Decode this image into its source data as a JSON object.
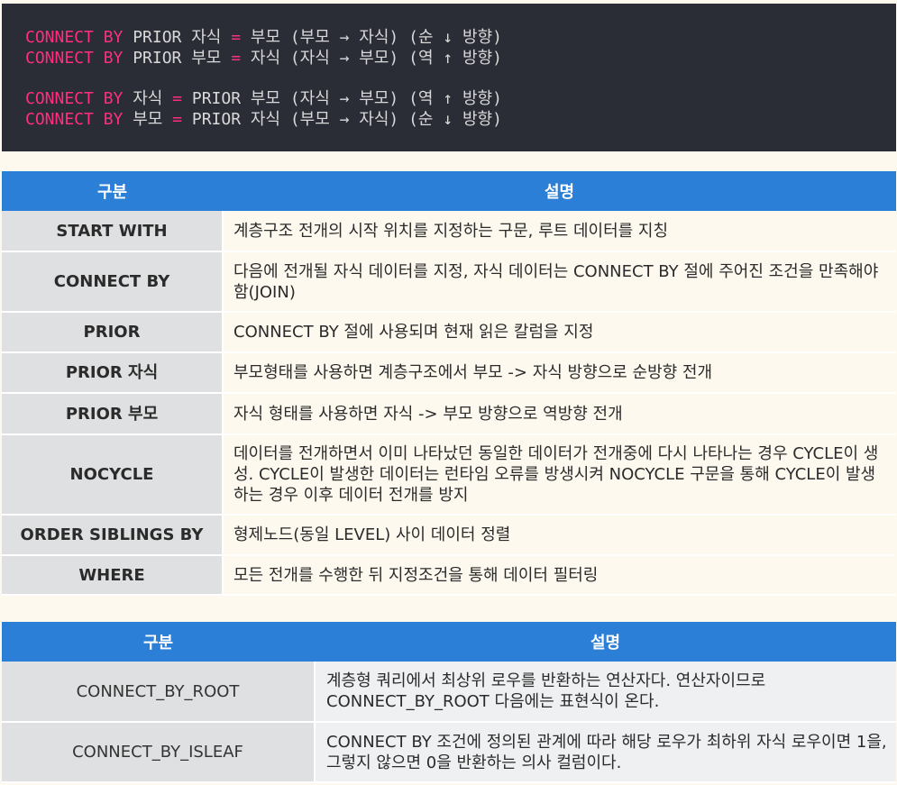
{
  "code": {
    "lines": [
      [
        {
          "t": "CONNECT BY",
          "c": "kw"
        },
        {
          "t": " PRIOR 자식 ",
          "c": ""
        },
        {
          "t": "=",
          "c": "op"
        },
        {
          "t": " 부모 (부모 → 자식) (순 ↓ 방향)",
          "c": ""
        }
      ],
      [
        {
          "t": "CONNECT BY",
          "c": "kw"
        },
        {
          "t": " PRIOR 부모 ",
          "c": ""
        },
        {
          "t": "=",
          "c": "op"
        },
        {
          "t": " 자식 (자식 → 부모) (역 ↑ 방향)",
          "c": ""
        }
      ],
      [
        {
          "t": "CONNECT BY",
          "c": "kw"
        },
        {
          "t": " 자식 ",
          "c": ""
        },
        {
          "t": "=",
          "c": "op"
        },
        {
          "t": " PRIOR 부모 (자식 → 부모) (역 ↑ 방향)",
          "c": ""
        }
      ],
      [
        {
          "t": "CONNECT BY",
          "c": "kw"
        },
        {
          "t": " 부모 ",
          "c": ""
        },
        {
          "t": "=",
          "c": "op"
        },
        {
          "t": " PRIOR 자식 (부모 → 자식) (순 ↓ 방향)",
          "c": ""
        }
      ]
    ]
  },
  "table1": {
    "header_key": "구분",
    "header_desc": "설명",
    "rows": [
      {
        "key": "START WITH",
        "desc": "계층구조 전개의 시작 위치를 지정하는 구문, 루트 데이터를 지칭"
      },
      {
        "key": "CONNECT BY",
        "desc": "다음에 전개될 자식 데이터를 지정, 자식 데이터는 CONNECT BY 절에 주어진 조건을 만족해야함(JOIN)"
      },
      {
        "key": "PRIOR",
        "desc": "CONNECT BY 절에 사용되며 현재 읽은 칼럼을 지정"
      },
      {
        "key": "PRIOR 자식",
        "desc": "부모형태를 사용하면 계층구조에서 부모 -> 자식 방향으로 순방향 전개"
      },
      {
        "key": "PRIOR 부모",
        "desc": "자식 형태를 사용하면 자식 -> 부모 방향으로 역방향 전개"
      },
      {
        "key": "NOCYCLE",
        "desc": "데이터를 전개하면서 이미 나타났던 동일한 데이터가 전개중에 다시 나타나는 경우 CYCLE이 생성. CYCLE이 발생한 데이터는 런타임 오류를 방생시켜 NOCYCLE 구문을 통해 CYCLE이 발생하는 경우 이후 데이터 전개를 방지"
      },
      {
        "key": "ORDER SIBLINGS BY",
        "desc": "형제노드(동일 LEVEL) 사이 데이터 정렬"
      },
      {
        "key": "WHERE",
        "desc": "모든 전개를 수행한 뒤 지정조건을 통해 데이터 필터링"
      }
    ]
  },
  "table2": {
    "header_key": "구분",
    "header_desc": "설명",
    "rows": [
      {
        "key": "CONNECT_BY_ROOT",
        "desc": "계층형 쿼리에서 최상위 로우를 반환하는 연산자다. 연산자이므로 CONNECT_BY_ROOT 다음에는 표현식이 온다."
      },
      {
        "key": "CONNECT_BY_ISLEAF",
        "desc": "CONNECT BY 조건에 정의된 관계에 따라 해당 로우가 최하위 자식 로우이면 1을, 그렇지 않으면 0을 반환하는 의사 컬럼이다."
      }
    ]
  }
}
